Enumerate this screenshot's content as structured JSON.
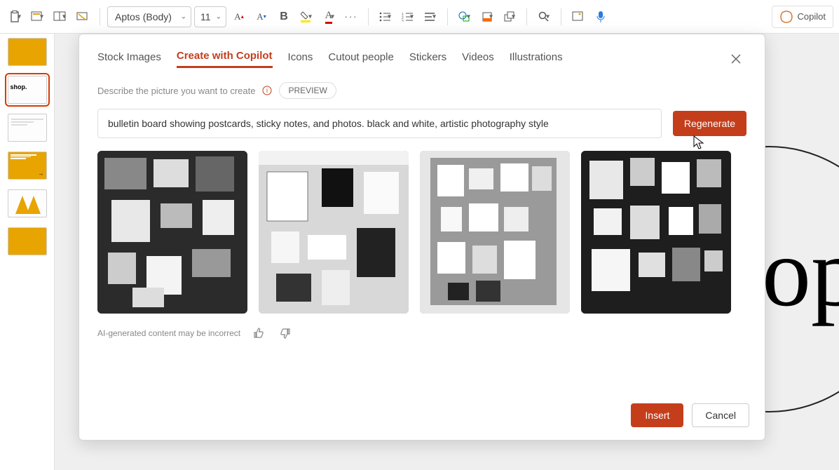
{
  "ribbon": {
    "font_name": "Aptos (Body)",
    "font_size": "11",
    "copilot_label": "Copilot"
  },
  "dialog": {
    "tabs": {
      "stock": "Stock Images",
      "copilot": "Create with Copilot",
      "icons": "Icons",
      "cutout": "Cutout people",
      "stickers": "Stickers",
      "videos": "Videos",
      "illustrations": "Illustrations"
    },
    "describe_label": "Describe the picture you want to create",
    "preview_chip": "PREVIEW",
    "prompt_value": "bulletin board showing postcards, sticky notes, and photos. black and white, artistic photography style",
    "regenerate_label": "Regenerate",
    "disclaimer": "AI-generated content may be incorrect",
    "insert_label": "Insert",
    "cancel_label": "Cancel"
  },
  "slide": {
    "thumb2_text": "shop.",
    "canvas_text_fragment": "op"
  }
}
